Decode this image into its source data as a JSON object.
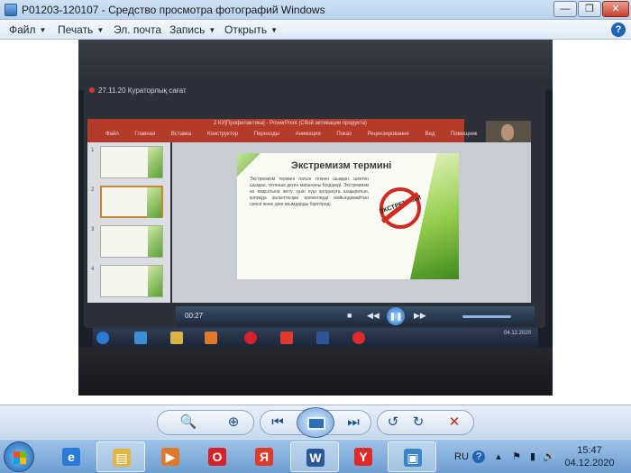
{
  "window": {
    "title": "P01203-120107 - Средство просмотра фотографий Windows",
    "min_glyph": "—",
    "max_glyph": "❐",
    "close_glyph": "✕"
  },
  "menu": {
    "items": [
      {
        "label": "Файл",
        "arrow": "▼"
      },
      {
        "label": "Печать",
        "arrow": "▼"
      },
      {
        "label": "Эл. почта",
        "arrow": ""
      },
      {
        "label": "Запись",
        "arrow": "▼"
      },
      {
        "label": "Открыть",
        "arrow": "▼"
      }
    ],
    "help_glyph": "?"
  },
  "photo": {
    "screen_title": "27.11.20 Кураторлық сағат",
    "ppt_title": "2 КУ[Профилактика] - PowerPoint (Сбой активации продукта)",
    "ppt_tabs": "Файл Главная Вставка Конструктор Переходы Анимация Показ Рецензирование Вид Помощник",
    "thumb_numbers": [
      "1",
      "2",
      "3",
      "4"
    ],
    "slide": {
      "heading": "Экстремизм термині",
      "body": "Экстремизм термині латын тілінен шыққан, шектен шыққан, төтенше деген мағынаны білдіреді. Экстремизм өз мақсатына жету үшін күш қолдануға шақыратын, қоғамда қалыптасқан ережелерді мойындамайтын саяси және діни ағымдарды біріктіреді.",
      "badge_word": "ЭКСТРЕМИЗМ"
    },
    "player": {
      "time": "00:27",
      "prev_glyph": "◀◀",
      "next_glyph": "▶▶",
      "play_glyph": "❚❚",
      "stop_glyph": "■"
    },
    "inner_clock": "04.12.2020"
  },
  "toolbar": {
    "zoom_glyph": "🔍",
    "fit_glyph": "⊕",
    "prev_glyph": "⏮",
    "next_glyph": "⏭",
    "rotate_left_glyph": "↺",
    "rotate_right_glyph": "↻",
    "delete_glyph": "✕"
  },
  "taskbar": {
    "items": [
      {
        "name": "ie",
        "glyph": "e",
        "color": "#2a7ad8"
      },
      {
        "name": "explorer",
        "glyph": "▤",
        "color": "#e0b445"
      },
      {
        "name": "media",
        "glyph": "▶",
        "color": "#e07a2a"
      },
      {
        "name": "opera",
        "glyph": "O",
        "color": "#d8202a"
      },
      {
        "name": "yandex",
        "glyph": "Я",
        "color": "#e03a2a"
      },
      {
        "name": "word",
        "glyph": "W",
        "color": "#2b579a"
      },
      {
        "name": "yandex-browser",
        "glyph": "Y",
        "color": "#e02a2a"
      },
      {
        "name": "photo-viewer",
        "glyph": "▣",
        "color": "#3b84c8"
      }
    ],
    "lang": "RU",
    "tray_help": "?",
    "tray_arrow": "▴",
    "tray_signal": "▮",
    "tray_volume": "🔊",
    "time": "15:47",
    "date": "04.12.2020"
  },
  "colors": {
    "ppt_ribbon": "#b43b2a",
    "slide_green": "#5aa032",
    "no_sign_red": "#d22a1e"
  }
}
